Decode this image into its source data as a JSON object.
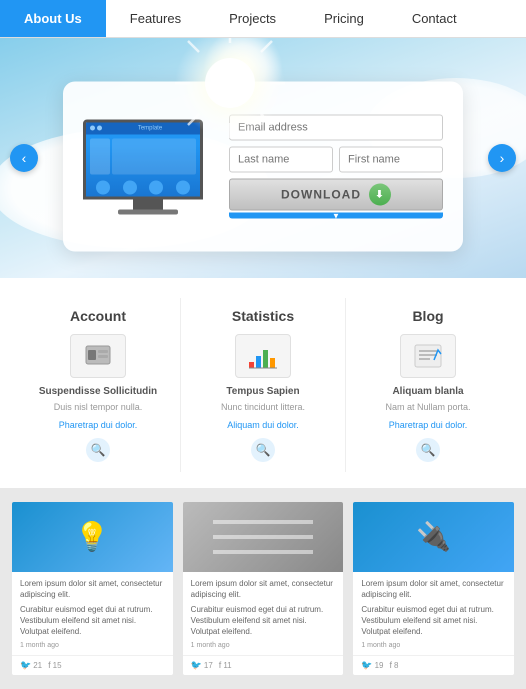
{
  "nav": {
    "items": [
      {
        "id": "about",
        "label": "About Us",
        "active": true
      },
      {
        "id": "features",
        "label": "Features",
        "active": false
      },
      {
        "id": "projects",
        "label": "Projects",
        "active": false
      },
      {
        "id": "pricing",
        "label": "Pricing",
        "active": false
      },
      {
        "id": "contact",
        "label": "Contact",
        "active": false
      }
    ]
  },
  "hero": {
    "email_placeholder": "Email address",
    "lastname_placeholder": "Last name",
    "firstname_placeholder": "First name",
    "download_label": "DOWNLOAD",
    "arrow_left": "‹",
    "arrow_right": "›"
  },
  "features": [
    {
      "id": "account",
      "title": "Account",
      "icon": "🗄️",
      "subtitle": "Suspendisse Sollicitudin",
      "text": "Duis nisl tempor nulla.",
      "link": "Pharetrap dui dolor."
    },
    {
      "id": "statistics",
      "title": "Statistics",
      "icon": "📊",
      "subtitle": "Tempus Sapien",
      "text": "Nunc tincidunt littera.",
      "link": "Aliquam dui dolor."
    },
    {
      "id": "blog",
      "title": "Blog",
      "icon": "📝",
      "subtitle": "Aliquam blanla",
      "text": "Nam at Nullam porta.",
      "link": "Pharetrap dui dolor."
    }
  ],
  "posts": [
    {
      "id": "post1",
      "image_type": "bulb",
      "image_icon": "💡",
      "text_short": "Lorem ipsum dolor sit amet, consectetur adipiscing elit.",
      "text_long": "Curabitur euismod eget dui at rutrum. Vestibulum eleifend sit amet nisi. Volutpat eleifend.",
      "time": "1 month ago",
      "twitter_count": "21",
      "fb_count": "15"
    },
    {
      "id": "post2",
      "image_type": "lines",
      "image_icon": "▬",
      "text_short": "Lorem ipsum dolor sit amet, consectetur adipiscing elit.",
      "text_long": "Curabitur euismod eget dui at rutrum. Vestibulum eleifend sit amet nisi. Volutpat eleifend.",
      "time": "1 month ago",
      "twitter_count": "17",
      "fb_count": "11"
    },
    {
      "id": "post3",
      "image_type": "plug",
      "image_icon": "🔌",
      "text_short": "Lorem ipsum dolor sit amet, consectetur adipiscing elit.",
      "text_long": "Curabitur euismod eget dui at rutrum. Vestibulum eleifend sit amet nisi. Volutpat eleifend.",
      "time": "1 month ago",
      "twitter_count": "19",
      "fb_count": "8"
    }
  ]
}
